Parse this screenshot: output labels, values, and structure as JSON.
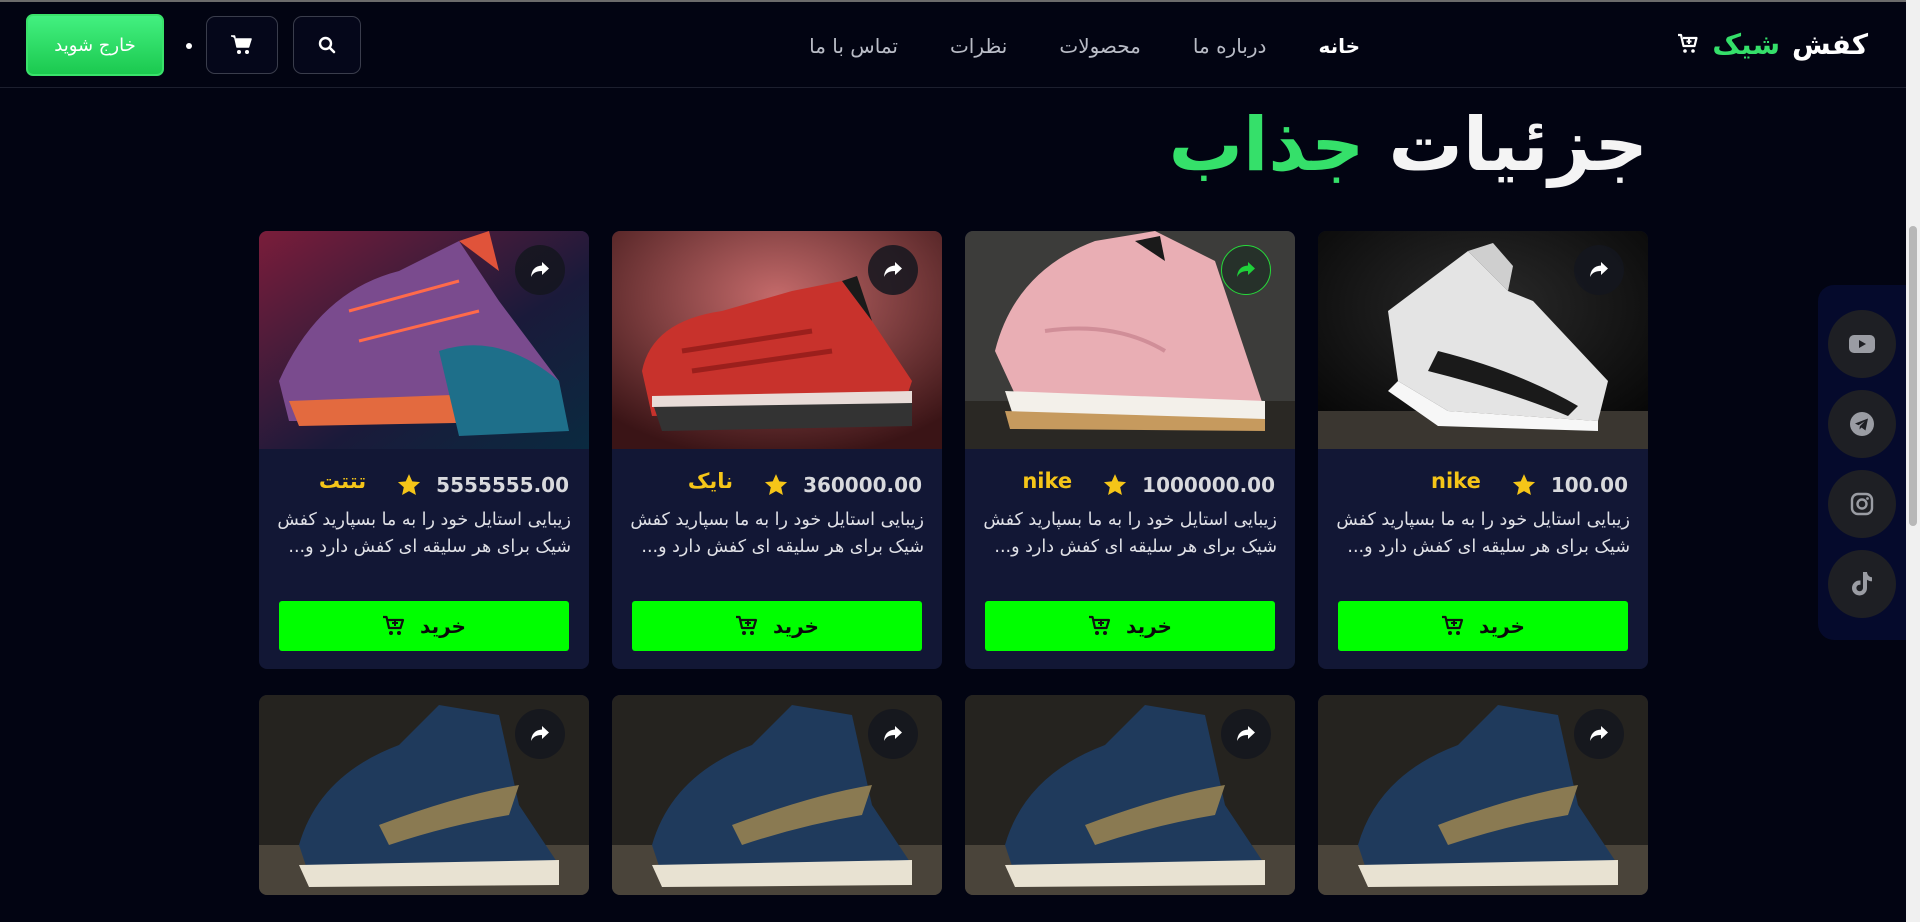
{
  "brand": {
    "word1": "کفش",
    "word2": "شیک",
    "accent_color": "#35e06a"
  },
  "nav": {
    "items": [
      {
        "label": "خانه",
        "active": true
      },
      {
        "label": "درباره ما",
        "active": false
      },
      {
        "label": "محصولات",
        "active": false
      },
      {
        "label": "نظرات",
        "active": false
      },
      {
        "label": "تماس با ما",
        "active": false
      }
    ],
    "exit_label": "خارج شوید",
    "cart_icon": "cart-icon",
    "search_icon": "search-icon"
  },
  "section": {
    "title_part1": "جزئیات",
    "title_part2": "جذاب"
  },
  "products": [
    {
      "price": "100.00",
      "brand": "nike",
      "desc": "زیبایی استایل خود را به ما بسپارید کفش شیک برای هر سلیقه ای کفش دارد و...",
      "buy_label": "خرید"
    },
    {
      "price": "1000000.00",
      "brand": "nike",
      "desc": "زیبایی استایل خود را به ما بسپارید کفش شیک برای هر سلیقه ای کفش دارد و...",
      "buy_label": "خرید"
    },
    {
      "price": "360000.00",
      "brand": "نایک",
      "desc": "زیبایی استایل خود را به ما بسپارید کفش شیک برای هر سلیقه ای کفش دارد و...",
      "buy_label": "خرید"
    },
    {
      "price": "5555555.00",
      "brand": "تتتت",
      "desc": "زیبایی استایل خود را به ما بسپارید کفش شیک برای هر سلیقه ای کفش دارد و...",
      "buy_label": "خرید"
    }
  ],
  "social": [
    "youtube-icon",
    "telegram-icon",
    "instagram-icon",
    "tiktok-icon"
  ]
}
